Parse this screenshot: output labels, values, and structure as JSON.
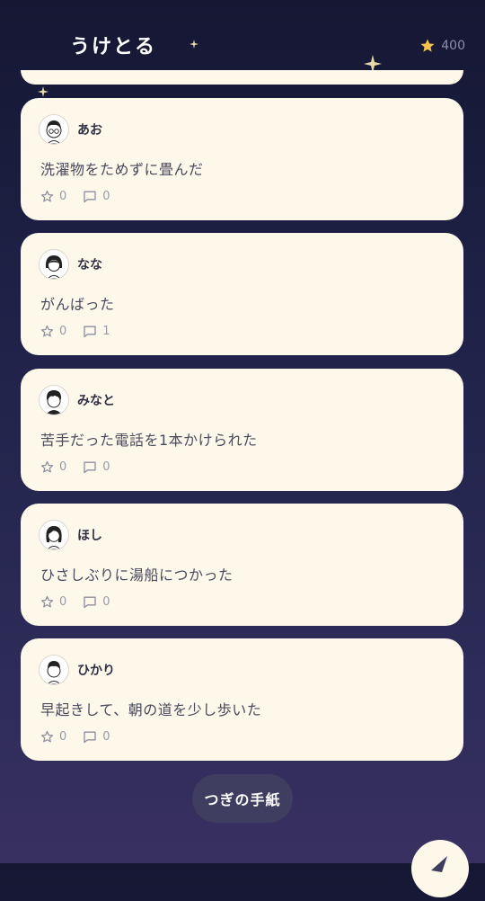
{
  "header": {
    "title": "うけとる",
    "points": "400",
    "points_icon": "star-icon"
  },
  "colors": {
    "card_bg": "#fdf8ea",
    "accent_star": "#f4c24d",
    "button_bg": "#3f3d60"
  },
  "posts": [
    {
      "name": "あお",
      "text": "洗濯物をためずに畳んだ",
      "stars": "0",
      "comments": "0",
      "avatar": "glasses-boy"
    },
    {
      "name": "なな",
      "text": "がんばった",
      "stars": "0",
      "comments": "1",
      "avatar": "bob-girl"
    },
    {
      "name": "みなと",
      "text": "苦手だった電話を1本かけられた",
      "stars": "0",
      "comments": "0",
      "avatar": "curly"
    },
    {
      "name": "ほし",
      "text": "ひさしぶりに湯船につかった",
      "stars": "0",
      "comments": "0",
      "avatar": "long-hair"
    },
    {
      "name": "ひかり",
      "text": "早起きして、朝の道を少し歩いた",
      "stars": "0",
      "comments": "0",
      "avatar": "short-hair"
    }
  ],
  "next_button": {
    "label": "つぎの手紙"
  }
}
